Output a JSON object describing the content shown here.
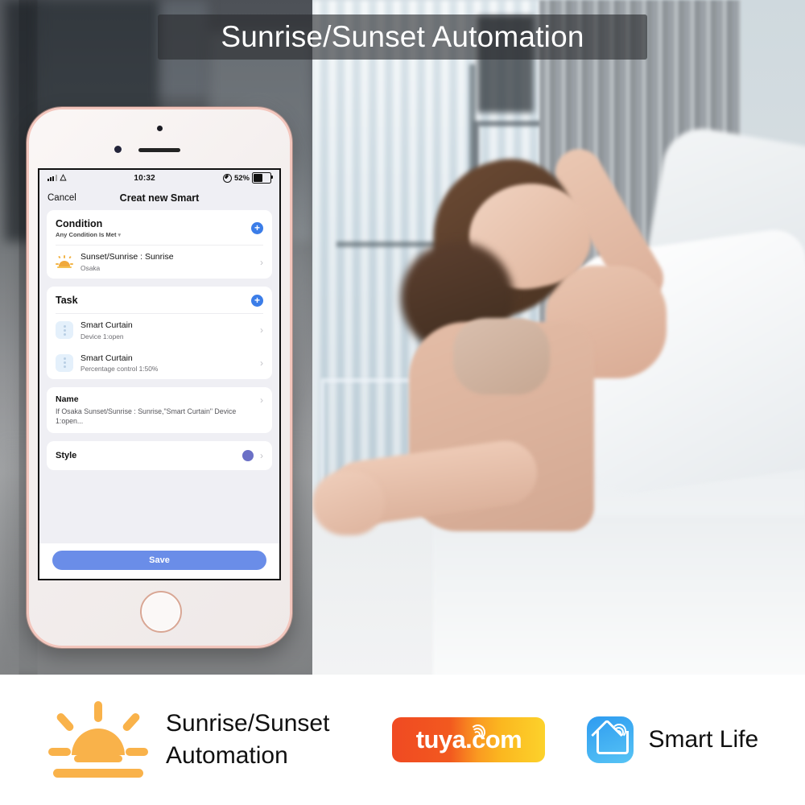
{
  "banner": {
    "title": "Sunrise/Sunset Automation"
  },
  "phone": {
    "status_bar": {
      "time": "10:32",
      "battery_percent": "52%",
      "signal_icon": "signal-bars-icon",
      "wifi_icon": "wifi-icon",
      "location_icon": "location-services-icon",
      "battery_icon": "battery-icon"
    },
    "nav": {
      "cancel": "Cancel",
      "title": "Creat new Smart"
    },
    "condition": {
      "title": "Condition",
      "subtitle": "Any Condition Is Met",
      "add_label": "+",
      "items": [
        {
          "icon": "sunrise-icon",
          "title": "Sunset/Sunrise : Sunrise",
          "subtitle": "Osaka",
          "chevron": "›"
        }
      ]
    },
    "task": {
      "title": "Task",
      "add_label": "+",
      "items": [
        {
          "icon": "curtain-device-icon",
          "title": "Smart Curtain",
          "subtitle": "Device 1:open",
          "chevron": "›"
        },
        {
          "icon": "curtain-device-icon",
          "title": "Smart Curtain",
          "subtitle": "Percentage control 1:50%",
          "chevron": "›"
        }
      ]
    },
    "name": {
      "title": "Name",
      "value": "If Osaka Sunset/Sunrise : Sunrise,\"Smart Curtain\" Device 1:open...",
      "chevron": "›"
    },
    "style": {
      "title": "Style",
      "color": "#6b70c6",
      "chevron": "›"
    },
    "save": {
      "label": "Save"
    }
  },
  "bottom": {
    "feature_icon": "sunrise-icon",
    "feature_title": "Sunrise/Sunset\nAutomation",
    "tuya": {
      "text": "tuya",
      "suffix": ".com",
      "wifi_icon": "wifi-arc-icon"
    },
    "smart_life": {
      "icon": "smart-life-app-icon",
      "label": "Smart Life"
    }
  },
  "colors": {
    "accent_blue": "#3b7de8",
    "save_blue": "#6a8de8",
    "sun_orange": "#F9B24A",
    "style_purple": "#6b70c6"
  }
}
